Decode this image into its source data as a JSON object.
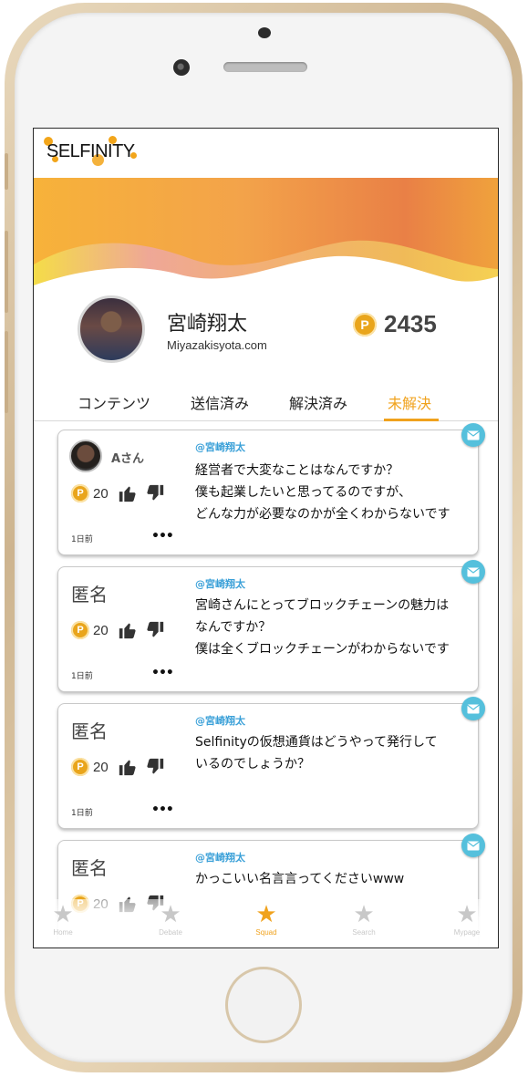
{
  "app": {
    "logo": "SELFINITY"
  },
  "profile": {
    "name": "宮崎翔太",
    "handle": "Miyazakisyota.com",
    "coin_symbol": "P",
    "points": "2435"
  },
  "tabs": [
    {
      "label": "コンテンツ",
      "active": false
    },
    {
      "label": "送信済み",
      "active": false
    },
    {
      "label": "解決済み",
      "active": false
    },
    {
      "label": "未解決",
      "active": true
    }
  ],
  "cards": [
    {
      "author": "Aさん",
      "has_avatar": true,
      "coin_symbol": "P",
      "votes": "20",
      "mention": "@宮崎翔太",
      "lines": [
        "経営者で大変なことはなんですか？",
        "僕も起業したいと思ってるのですが、",
        "どんな力が必要なのかが全くわからないです"
      ],
      "time": "1日前",
      "more": "•••"
    },
    {
      "author": "匿名",
      "has_avatar": false,
      "coin_symbol": "P",
      "votes": "20",
      "mention": "@宮崎翔太",
      "lines": [
        "宮崎さんにとってブロックチェーンの魅力は",
        "なんですか？",
        "僕は全くブロックチェーンがわからないです"
      ],
      "time": "1日前",
      "more": "•••"
    },
    {
      "author": "匿名",
      "has_avatar": false,
      "coin_symbol": "P",
      "votes": "20",
      "mention": "@宮崎翔太",
      "lines": [
        "Selfinityの仮想通貨はどうやって発行して",
        "いるのでしょうか？"
      ],
      "time": "1日前",
      "more": "•••"
    },
    {
      "author": "匿名",
      "has_avatar": false,
      "coin_symbol": "P",
      "votes": "20",
      "mention": "@宮崎翔太",
      "lines": [
        "かっこいい名言言ってくださいwww"
      ],
      "time": "",
      "more": ""
    }
  ],
  "bottom_nav": [
    {
      "label": "Home",
      "icon": "star-icon",
      "active": false
    },
    {
      "label": "Debate",
      "icon": "star-icon",
      "active": false
    },
    {
      "label": "Squad",
      "icon": "star-icon",
      "active": true
    },
    {
      "label": "Search",
      "icon": "star-icon",
      "active": false
    },
    {
      "label": "Mypage",
      "icon": "star-icon",
      "active": false
    }
  ],
  "colors": {
    "accent": "#f0a21d",
    "mention": "#3aa0d8",
    "mail_badge": "#55c0dc",
    "coin": "#e9a51c",
    "phone_gold": "#d8c2a0"
  }
}
